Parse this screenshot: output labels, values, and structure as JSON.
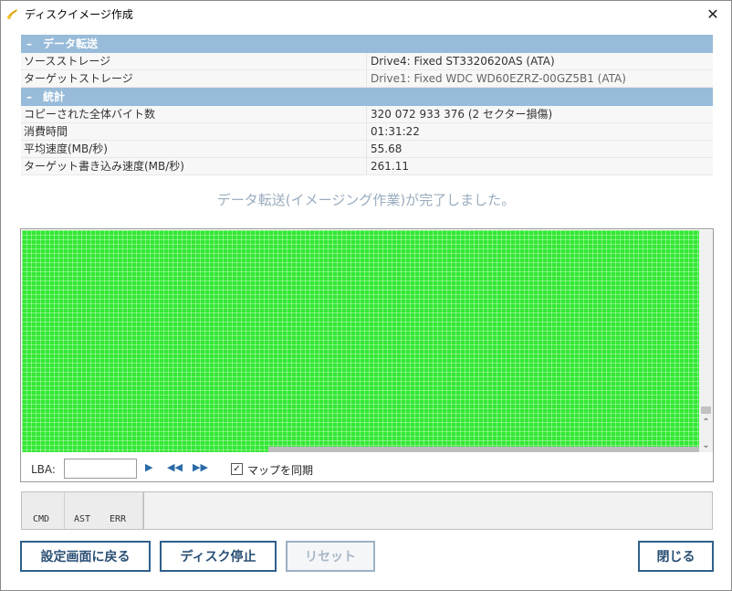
{
  "window": {
    "title": "ディスクイメージ作成",
    "close_glyph": "✕"
  },
  "sections": {
    "transfer": {
      "header": "データ転送",
      "rows": [
        {
          "key": "ソースストレージ",
          "value": "Drive4: Fixed ST3320620AS (ATA)"
        },
        {
          "key": "ターゲットストレージ",
          "value": "Drive1: Fixed WDC WD60EZRZ-00GZ5B1 (ATA)"
        }
      ]
    },
    "stats": {
      "header": "統計",
      "rows": [
        {
          "key": "コピーされた全体バイト数",
          "value": "320 072 933 376 (2 セクター損傷)"
        },
        {
          "key": "消費時間",
          "value": "01:31:22"
        },
        {
          "key": "平均速度(MB/秒)",
          "value": "55.68"
        },
        {
          "key": "ターゲット書き込み速度(MB/秒)",
          "value": "261.11"
        }
      ]
    }
  },
  "status_message": "データ転送(イメージング作業)が完了しました。",
  "map": {
    "lba_label": "LBA:",
    "lba_value": "",
    "sync_label": "マップを同期",
    "sync_checked": true,
    "good_color": "#33e833",
    "unread_color": "#bdbdbd"
  },
  "registers": {
    "cmd": "CMD",
    "ast": "AST",
    "err": "ERR"
  },
  "buttons": {
    "settings": "設定画面に戻る",
    "stop": "ディスク停止",
    "reset": "リセット",
    "close": "閉じる"
  }
}
